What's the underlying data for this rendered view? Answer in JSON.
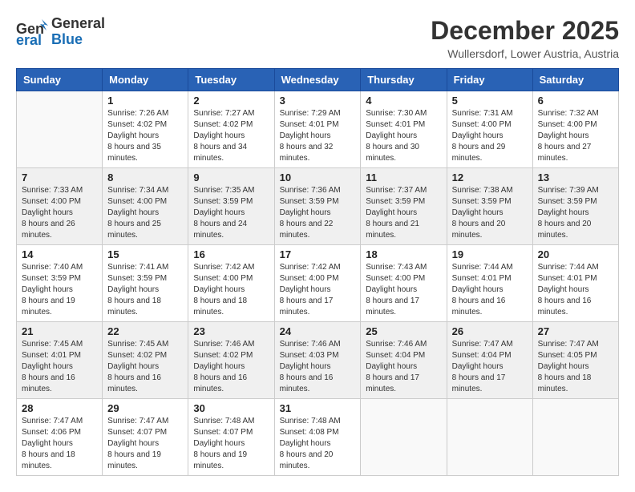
{
  "header": {
    "logo_general": "General",
    "logo_blue": "Blue",
    "month": "December 2025",
    "location": "Wullersdorf, Lower Austria, Austria"
  },
  "days_of_week": [
    "Sunday",
    "Monday",
    "Tuesday",
    "Wednesday",
    "Thursday",
    "Friday",
    "Saturday"
  ],
  "weeks": [
    [
      {
        "day": "",
        "empty": true
      },
      {
        "day": "1",
        "sunrise": "7:26 AM",
        "sunset": "4:02 PM",
        "daylight": "8 hours and 35 minutes."
      },
      {
        "day": "2",
        "sunrise": "7:27 AM",
        "sunset": "4:02 PM",
        "daylight": "8 hours and 34 minutes."
      },
      {
        "day": "3",
        "sunrise": "7:29 AM",
        "sunset": "4:01 PM",
        "daylight": "8 hours and 32 minutes."
      },
      {
        "day": "4",
        "sunrise": "7:30 AM",
        "sunset": "4:01 PM",
        "daylight": "8 hours and 30 minutes."
      },
      {
        "day": "5",
        "sunrise": "7:31 AM",
        "sunset": "4:00 PM",
        "daylight": "8 hours and 29 minutes."
      },
      {
        "day": "6",
        "sunrise": "7:32 AM",
        "sunset": "4:00 PM",
        "daylight": "8 hours and 27 minutes."
      }
    ],
    [
      {
        "day": "7",
        "sunrise": "7:33 AM",
        "sunset": "4:00 PM",
        "daylight": "8 hours and 26 minutes."
      },
      {
        "day": "8",
        "sunrise": "7:34 AM",
        "sunset": "4:00 PM",
        "daylight": "8 hours and 25 minutes."
      },
      {
        "day": "9",
        "sunrise": "7:35 AM",
        "sunset": "3:59 PM",
        "daylight": "8 hours and 24 minutes."
      },
      {
        "day": "10",
        "sunrise": "7:36 AM",
        "sunset": "3:59 PM",
        "daylight": "8 hours and 22 minutes."
      },
      {
        "day": "11",
        "sunrise": "7:37 AM",
        "sunset": "3:59 PM",
        "daylight": "8 hours and 21 minutes."
      },
      {
        "day": "12",
        "sunrise": "7:38 AM",
        "sunset": "3:59 PM",
        "daylight": "8 hours and 20 minutes."
      },
      {
        "day": "13",
        "sunrise": "7:39 AM",
        "sunset": "3:59 PM",
        "daylight": "8 hours and 20 minutes."
      }
    ],
    [
      {
        "day": "14",
        "sunrise": "7:40 AM",
        "sunset": "3:59 PM",
        "daylight": "8 hours and 19 minutes."
      },
      {
        "day": "15",
        "sunrise": "7:41 AM",
        "sunset": "3:59 PM",
        "daylight": "8 hours and 18 minutes."
      },
      {
        "day": "16",
        "sunrise": "7:42 AM",
        "sunset": "4:00 PM",
        "daylight": "8 hours and 18 minutes."
      },
      {
        "day": "17",
        "sunrise": "7:42 AM",
        "sunset": "4:00 PM",
        "daylight": "8 hours and 17 minutes."
      },
      {
        "day": "18",
        "sunrise": "7:43 AM",
        "sunset": "4:00 PM",
        "daylight": "8 hours and 17 minutes."
      },
      {
        "day": "19",
        "sunrise": "7:44 AM",
        "sunset": "4:01 PM",
        "daylight": "8 hours and 16 minutes."
      },
      {
        "day": "20",
        "sunrise": "7:44 AM",
        "sunset": "4:01 PM",
        "daylight": "8 hours and 16 minutes."
      }
    ],
    [
      {
        "day": "21",
        "sunrise": "7:45 AM",
        "sunset": "4:01 PM",
        "daylight": "8 hours and 16 minutes."
      },
      {
        "day": "22",
        "sunrise": "7:45 AM",
        "sunset": "4:02 PM",
        "daylight": "8 hours and 16 minutes."
      },
      {
        "day": "23",
        "sunrise": "7:46 AM",
        "sunset": "4:02 PM",
        "daylight": "8 hours and 16 minutes."
      },
      {
        "day": "24",
        "sunrise": "7:46 AM",
        "sunset": "4:03 PM",
        "daylight": "8 hours and 16 minutes."
      },
      {
        "day": "25",
        "sunrise": "7:46 AM",
        "sunset": "4:04 PM",
        "daylight": "8 hours and 17 minutes."
      },
      {
        "day": "26",
        "sunrise": "7:47 AM",
        "sunset": "4:04 PM",
        "daylight": "8 hours and 17 minutes."
      },
      {
        "day": "27",
        "sunrise": "7:47 AM",
        "sunset": "4:05 PM",
        "daylight": "8 hours and 18 minutes."
      }
    ],
    [
      {
        "day": "28",
        "sunrise": "7:47 AM",
        "sunset": "4:06 PM",
        "daylight": "8 hours and 18 minutes."
      },
      {
        "day": "29",
        "sunrise": "7:47 AM",
        "sunset": "4:07 PM",
        "daylight": "8 hours and 19 minutes."
      },
      {
        "day": "30",
        "sunrise": "7:48 AM",
        "sunset": "4:07 PM",
        "daylight": "8 hours and 19 minutes."
      },
      {
        "day": "31",
        "sunrise": "7:48 AM",
        "sunset": "4:08 PM",
        "daylight": "8 hours and 20 minutes."
      },
      {
        "day": "",
        "empty": true
      },
      {
        "day": "",
        "empty": true
      },
      {
        "day": "",
        "empty": true
      }
    ]
  ]
}
